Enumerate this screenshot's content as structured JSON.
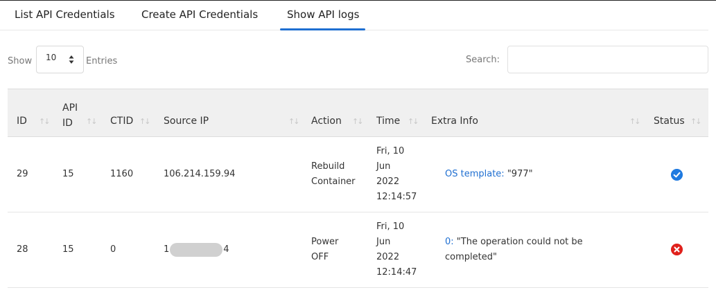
{
  "tabs": [
    {
      "label": "List API Credentials",
      "active": false
    },
    {
      "label": "Create API Credentials",
      "active": false
    },
    {
      "label": "Show API logs",
      "active": true
    }
  ],
  "controls": {
    "show_label": "Show",
    "entries_value": "10",
    "entries_label": "Entries",
    "search_label": "Search:",
    "search_value": ""
  },
  "table": {
    "headers": [
      "ID",
      "API ID",
      "CTID",
      "Source IP",
      "Action",
      "Time",
      "Extra Info",
      "Status"
    ],
    "rows": [
      {
        "id": "29",
        "api_id": "15",
        "ctid": "1160",
        "source_ip": "106.214.159.94",
        "action": [
          "Rebuild",
          "Container"
        ],
        "time": [
          "Fri, 10",
          "Jun",
          "2022",
          "12:14:57"
        ],
        "extra_key": "OS template:",
        "extra_value": " \"977\"",
        "status": "success"
      },
      {
        "id": "28",
        "api_id": "15",
        "ctid": "0",
        "source_ip_prefix": "1",
        "source_ip_suffix": "4",
        "action": [
          "Power",
          "OFF"
        ],
        "time": [
          "Fri, 10",
          "Jun",
          "2022",
          "12:14:47"
        ],
        "extra_key": "0:",
        "extra_value": " \"The operation could not be completed\"",
        "status": "error"
      }
    ]
  },
  "colors": {
    "accent": "#1f6fd1",
    "success": "#1f7ae0",
    "error": "#e0211c",
    "header_bg": "#f0f0f0"
  },
  "icons": {
    "sort": "sort-arrows-icon",
    "select": "select-caret-icon",
    "success": "check-circle-icon",
    "error": "x-circle-icon"
  }
}
